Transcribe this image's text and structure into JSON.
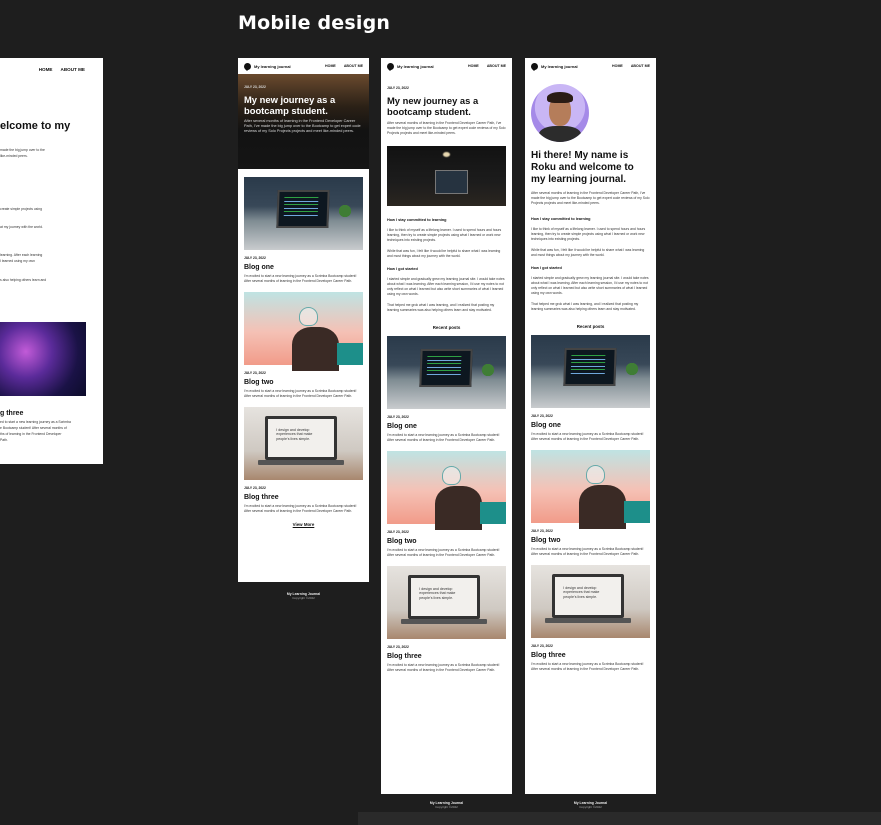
{
  "canvas": {
    "heading": "Mobile design"
  },
  "desktop_partial": {
    "nav_links": [
      "HOME",
      "ABOUT ME"
    ],
    "hero_title_fragment": "elcome to my",
    "line1": "made the big jump over to the",
    "line2": "like-minded peers.",
    "line3": "create simple projects using",
    "line4": "at my journey with the world.",
    "line5": "learning. After each learning",
    "line6": "I learned using my own",
    "line7": "s also helping others learn and",
    "card_title": "g three",
    "card_text1": "ed to start a new learning journey as a Scrimba",
    "card_text2": "e Bootcamp student! After several months of",
    "card_text3": "ths of learning in the Frontend Developer",
    "card_text4": "Path."
  },
  "brand": "My learning journal",
  "nav": {
    "home": "HOME",
    "about": "ABOUT ME"
  },
  "phone1": {
    "hero_date": "JULY 23, 2022",
    "hero_title": "My new journey as a bootcamp student.",
    "hero_text": "After several months of learning in the Frontend Developer Career Path, I've made the big jump over to the Bootcamp to get expert code reviews of my Solo Projects projects and meet like-minded peers.",
    "posts": [
      {
        "date": "JULY 23, 2022",
        "title": "Blog one",
        "text": "I'm excited to start a new learning journey as a Scrimba Bootcamp student! After several months of learning in the Frontend Developer Career Path."
      },
      {
        "date": "JULY 23, 2022",
        "title": "Blog two",
        "text": "I'm excited to start a new learning journey as a Scrimba Bootcamp student! After several months of learning in the Frontend Developer Career Path."
      },
      {
        "date": "JULY 23, 2022",
        "title": "Blog three",
        "text": "I'm excited to start a new learning journey as a Scrimba Bootcamp student! After several months of learning in the Frontend Developer Career Path."
      }
    ],
    "view_more": "View More",
    "footer_title": "My Learning Journal",
    "footer_copy": "Copyright ©2022"
  },
  "phone2": {
    "date": "JULY 23, 2022",
    "title": "My new journey as a bootcamp student.",
    "intro": "After several months of learning in the Frontend Developer Career Path, I've made the big jump over to the Bootcamp to get expert code reviews of my Solo Projects projects and meet like-minded peers.",
    "h1": "How I stay committed to learning",
    "p1": "I like to think of myself as a lifelong learner. I used to spend hours and hours learning, then try to create simple projects using what I learned or work new techniques into existing projects.",
    "p2": "While that was fun, I felt like it would be helpful to share what I was learning and most things about my journey with the world.",
    "h2": "How I got started",
    "p3": "I started simple and gradually grew my learning journal site. I would take notes about what I was learning. After each learning session, I'd use my notes to not only reflect on what I learned but also write short summaries of what I learned using my own words.",
    "p4": "That helped me grok what I was learning, and I realized that posting my learning summaries was also helping others learn and stay motivated.",
    "recent": "Recent posts",
    "posts": [
      {
        "date": "JULY 23, 2022",
        "title": "Blog one",
        "text": "I'm excited to start a new learning journey as a Scrimba Bootcamp student! After several months of learning in the Frontend Developer Career Path."
      },
      {
        "date": "JULY 23, 2022",
        "title": "Blog two",
        "text": "I'm excited to start a new learning journey as a Scrimba Bootcamp student! After several months of learning in the Frontend Developer Career Path."
      },
      {
        "date": "JULY 23, 2022",
        "title": "Blog three",
        "text": "I'm excited to start a new learning journey as a Scrimba Bootcamp student! After several months of learning in the Frontend Developer Career Path."
      }
    ],
    "footer_title": "My Learning Journal",
    "footer_copy": "Copyright ©2022"
  },
  "phone3": {
    "title": "Hi there! My name is Roku and welcome to my learning journal.",
    "intro": "After several months of learning in the Frontend Developer Career Path, I've made the big jump over to the Bootcamp to get expert code reviews of my Solo Projects projects and meet like-minded peers.",
    "h1": "How I stay committed to learning",
    "p1": "I like to think of myself as a lifelong learner. I used to spend hours and hours learning, then try to create simple projects using what I learned or work new techniques into existing projects.",
    "p2": "While that was fun, I felt like it would be helpful to share what I was learning and most things about my journey with the world.",
    "h2": "How I got started",
    "p3": "I started simple and gradually grew my learning journal site. I would take notes about what I was learning. After each learning session, I'd use my notes to not only reflect on what I learned but also write short summaries of what I learned using my own words.",
    "p4": "That helped me grok what I was learning, and I realized that posting my learning summaries was also helping others learn and stay motivated.",
    "recent": "Recent posts",
    "posts": [
      {
        "date": "JULY 23, 2022",
        "title": "Blog one",
        "text": "I'm excited to start a new learning journey as a Scrimba Bootcamp student! After several months of learning in the Frontend Developer Career Path."
      },
      {
        "date": "JULY 23, 2022",
        "title": "Blog two",
        "text": "I'm excited to start a new learning journey as a Scrimba Bootcamp student! After several months of learning in the Frontend Developer Career Path."
      },
      {
        "date": "JULY 23, 2022",
        "title": "Blog three",
        "text": "I'm excited to start a new learning journey as a Scrimba Bootcamp student! After several months of learning in the Frontend Developer Career Path."
      }
    ],
    "footer_title": "My Learning Journal",
    "footer_copy": "Copyright ©2022"
  }
}
